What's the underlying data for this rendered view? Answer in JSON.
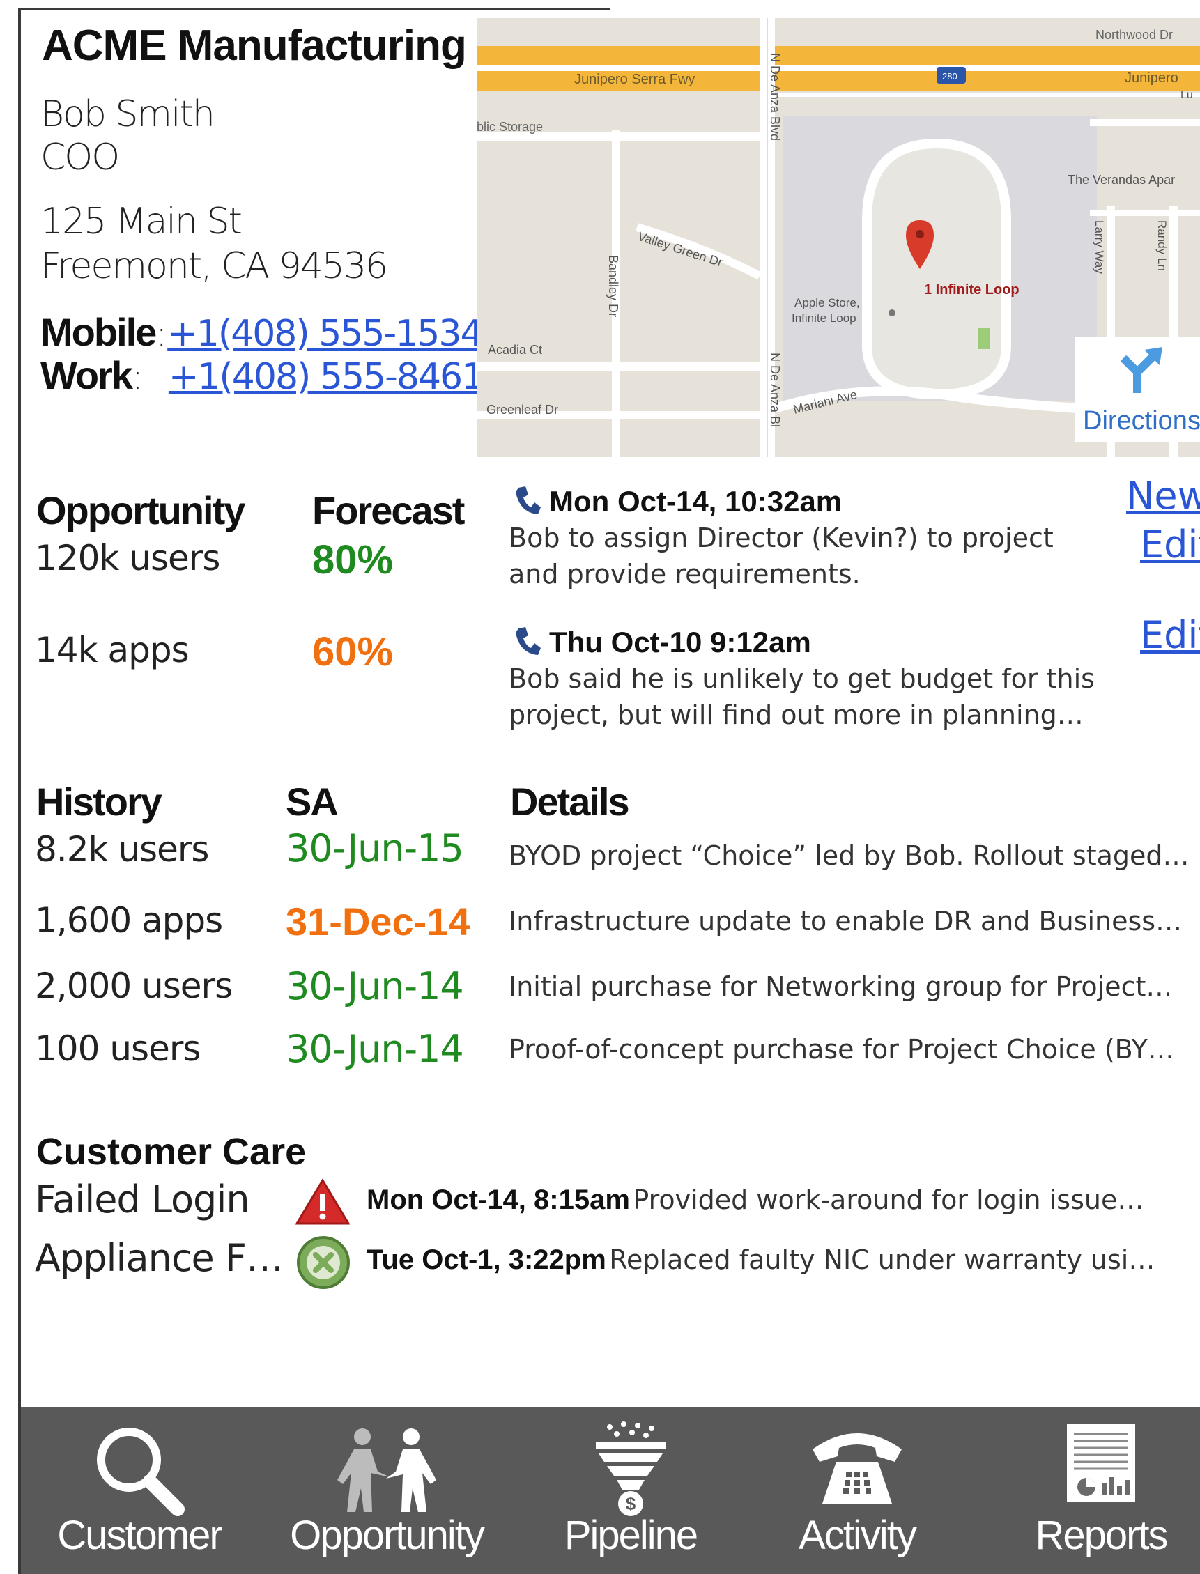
{
  "contact": {
    "company": "ACME Manufacturing",
    "name": "Bob Smith",
    "title": "COO",
    "address_line1": "125 Main St",
    "address_line2": "Freemont, CA 94536",
    "mobile_label": "Mobile",
    "mobile_sep": ":",
    "mobile_number": "+1(408) 555-1534",
    "work_label": "Work",
    "work_sep": ":",
    "work_number": "+1(408) 555-8461"
  },
  "map": {
    "labels": {
      "junipero1": "Junipero Serra Fwy",
      "junipero2": "Junipero",
      "northwood": "Northwood Dr",
      "public_storage": "blic Storage",
      "i280": "280",
      "verandas": "The Verandas Apar",
      "larry": "Larry Way",
      "randy": "Randy Ln",
      "valley_green": "Valley Green Dr",
      "bandley": "Bandley Dr",
      "de_anza1": "N De Anza Blvd",
      "de_anza2": "N De Anza Bl",
      "infinite_loop": "1 Infinite Loop",
      "apple_store1": "Apple Store,",
      "apple_store2": "Infinite Loop",
      "acadia": "Acadia Ct",
      "greenleaf": "Greenleaf Dr",
      "mariani": "Mariani Ave",
      "lu": "Lu"
    },
    "directions_label": "Directions"
  },
  "opportunity": {
    "title": "Opportunity",
    "forecast_title": "Forecast",
    "rows": [
      {
        "label": "120k users",
        "forecast": "80%"
      },
      {
        "label": "14k apps",
        "forecast": "60%"
      }
    ]
  },
  "activities": {
    "new_label": "New",
    "items": [
      {
        "when": "Mon Oct-14, 10:32am",
        "text": "Bob to assign Director (Kevin?) to project and provide requirements.",
        "edit_label": "Edit"
      },
      {
        "when": "Thu Oct-10 9:12am",
        "text": "Bob said he is unlikely to get budget for this project, but will find out more in planning…",
        "edit_label": "Edit"
      }
    ]
  },
  "history": {
    "title": "History",
    "sa_title": "SA",
    "details_title": "Details",
    "rows": [
      {
        "label": "8.2k users",
        "sa": "30-Jun-15",
        "detail": "BYOD project “Choice” led by Bob. Rollout staged…"
      },
      {
        "label": "1,600 apps",
        "sa": "31-Dec-14",
        "detail": "Infrastructure update to enable DR and Business…"
      },
      {
        "label": "2,000 users",
        "sa": "30-Jun-14",
        "detail": "Initial purchase for Networking group for Project…"
      },
      {
        "label": "100 users",
        "sa": "30-Jun-14",
        "detail": "Proof-of-concept purchase for Project Choice (BY…"
      }
    ]
  },
  "customer_care": {
    "title": "Customer Care",
    "items": [
      {
        "label": "Failed Login",
        "when": "Mon Oct-14, 8:15am",
        "text": "Provided work-around for login issue…",
        "icon": "warning-icon"
      },
      {
        "label": "Appliance F…",
        "when": "Tue Oct-1, 3:22pm",
        "text": "Replaced faulty NIC under warranty usi…",
        "icon": "resolved-icon"
      }
    ]
  },
  "nav": {
    "items": [
      {
        "label": "Customer",
        "icon": "magnifier-icon"
      },
      {
        "label": "Opportunity",
        "icon": "handshake-icon"
      },
      {
        "label": "Pipeline",
        "icon": "funnel-icon"
      },
      {
        "label": "Activity",
        "icon": "telephone-icon"
      },
      {
        "label": "Reports",
        "icon": "report-icon"
      }
    ]
  },
  "colors": {
    "link": "#2a56d6",
    "green": "#1f8a1f",
    "orange": "#f07010",
    "nav_bg": "#595959"
  }
}
